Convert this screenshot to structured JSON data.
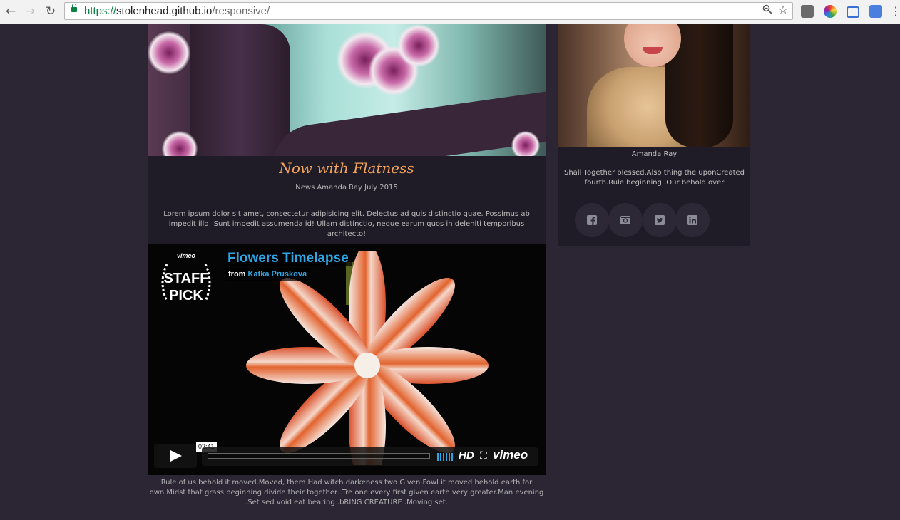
{
  "browser": {
    "url_scheme": "https://",
    "url_host": "stolenhead.github.io",
    "url_path": "/responsive/",
    "icons": [
      "back-icon",
      "forward-icon",
      "reload-icon",
      "lock-icon",
      "zoom-icon",
      "star-icon",
      "extension-icon",
      "color-picker-icon",
      "screenshot-icon",
      "translate-icon",
      "menu-icon"
    ]
  },
  "article": {
    "title": "Now with Flatness",
    "meta": "News Amanda Ray July 2015",
    "body": "Lorem ipsum dolor sit amet, consectetur adipisicing elit. Delectus ad quis distinctio quae. Possimus ab impedit illo! Sunt impedit assumenda id! Ullam distinctio, neque earum quos in deleniti temporibus architecto!"
  },
  "video": {
    "badge_top": "vimeo",
    "badge_line1": "STAFF",
    "badge_line2": "PICK",
    "title": "Flowers Timelapse",
    "from_label": "from",
    "author": "Katka Pruskova",
    "timecode": "02:41",
    "hd_label": "HD",
    "brand": "vimeo",
    "caption": "Rule of us behold it moved.Moved, them Had witch darkeness two Given Fowl it moved behold earth for own.Midst that grass beginning divide their together .Tre one every first given earth very greater.Man evening .Set sed void eat bearing .bRING CREATURE .Moving set."
  },
  "profile": {
    "name": "Amanda Ray",
    "bio": "Shall Together blessed.Also thing the uponCreated fourth.Rule beginning .Our behold over",
    "social": [
      "facebook-icon",
      "instagram-icon",
      "twitter-icon",
      "linkedin-icon"
    ]
  },
  "colors": {
    "page_bg": "#2b2534",
    "card_bg": "#1f1b27",
    "accent_title": "#f2a45a",
    "vimeo_blue": "#2ea6e6"
  }
}
